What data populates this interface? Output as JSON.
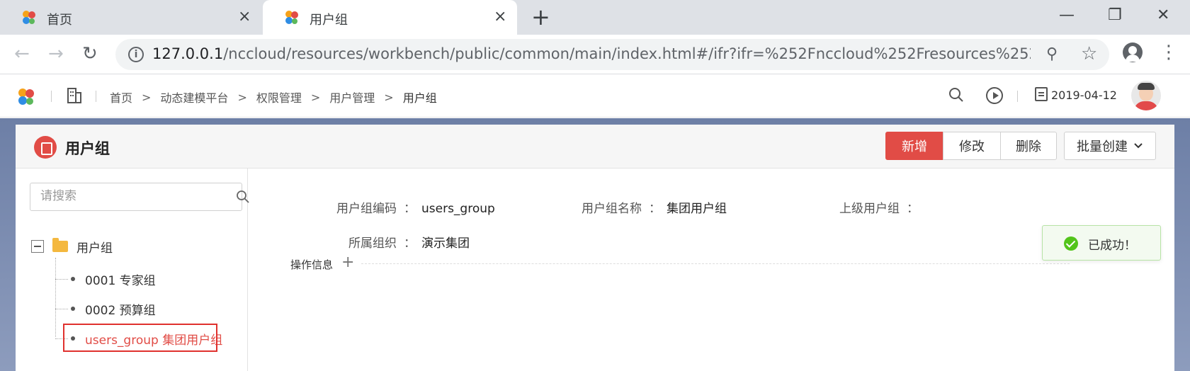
{
  "browser": {
    "tabs": [
      {
        "label": "首页",
        "active": false
      },
      {
        "label": "用户组",
        "active": true
      }
    ],
    "new_tab_label": "+",
    "url_host": "127.0.0.1",
    "url_path": "/nccloud/resources/workbench/public/common/main/index.html#/ifr?ifr=%252Fnccloud%252Fresources%252Fu...",
    "icons": {
      "close": "×",
      "minimize": "—",
      "restore": "❐",
      "window_close": "✕",
      "back": "←",
      "forward": "→",
      "reload": "↻",
      "zoom": "⚲",
      "star": "☆",
      "menu": "⋮"
    }
  },
  "header": {
    "breadcrumbs": [
      "首页",
      "动态建模平台",
      "权限管理",
      "用户管理",
      "用户组"
    ],
    "crumb_separator": ">",
    "date": "2019-04-12"
  },
  "page": {
    "title": "用户组",
    "buttons": {
      "add": "新增",
      "edit": "修改",
      "delete": "删除",
      "batch_create": "批量创建"
    }
  },
  "tree": {
    "search_placeholder": "请搜索",
    "root_label": "用户组",
    "children": [
      {
        "label": "0001 专家组",
        "selected": false
      },
      {
        "label": "0002 预算组",
        "selected": false
      },
      {
        "label": "users_group 集团用户组",
        "selected": true
      }
    ]
  },
  "detail": {
    "fields": [
      {
        "label": "用户组编码",
        "value": "users_group"
      },
      {
        "label": "用户组名称",
        "value": "集团用户组"
      },
      {
        "label": "上级用户组",
        "value": ""
      },
      {
        "label": "所属组织",
        "value": "演示集团"
      }
    ],
    "colon": "：",
    "ops_label": "操作信息"
  },
  "toast": {
    "message": "已成功！",
    "color": "#52c41a"
  },
  "colors": {
    "brand_red": "#e14c46",
    "selection_outline": "#e0312e"
  }
}
